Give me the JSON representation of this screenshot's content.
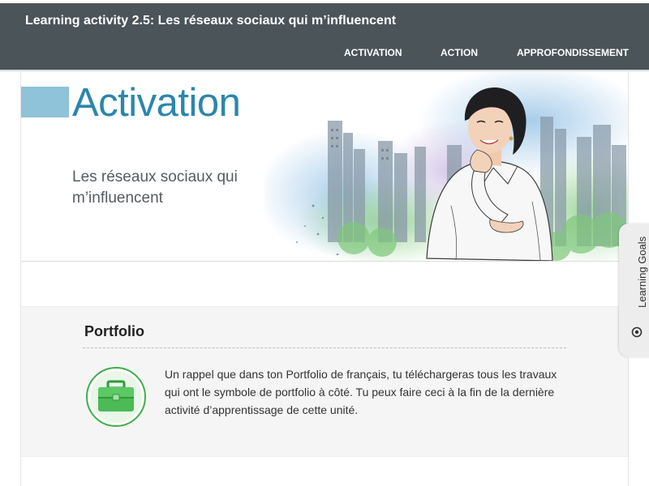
{
  "header": {
    "title": "Learning activity 2.5: Les réseaux sociaux qui m’influencent",
    "nav": {
      "activation": "ACTIVATION",
      "action": "ACTION",
      "approfondissement": "APPROFONDISSEMENT"
    }
  },
  "hero": {
    "heading": "Activation",
    "subtitle": "Les réseaux sociaux qui m’influencent"
  },
  "portfolio": {
    "title": "Portfolio",
    "icon": "briefcase-icon",
    "text": "Un rappel que dans ton Portfolio de français, tu téléchargeras tous les travaux qui ont le symbole de portfolio à côté. Tu peux faire ceci à la fin de la dernière activité d’apprentissage de cette unité."
  },
  "side_tab": {
    "label": "Learning Goals",
    "icon": "target-icon"
  },
  "colors": {
    "header_bg": "#4b5458",
    "accent_blue": "#2b86ab",
    "accent_square": "#8ec3d9",
    "portfolio_green": "#3fae4a"
  }
}
